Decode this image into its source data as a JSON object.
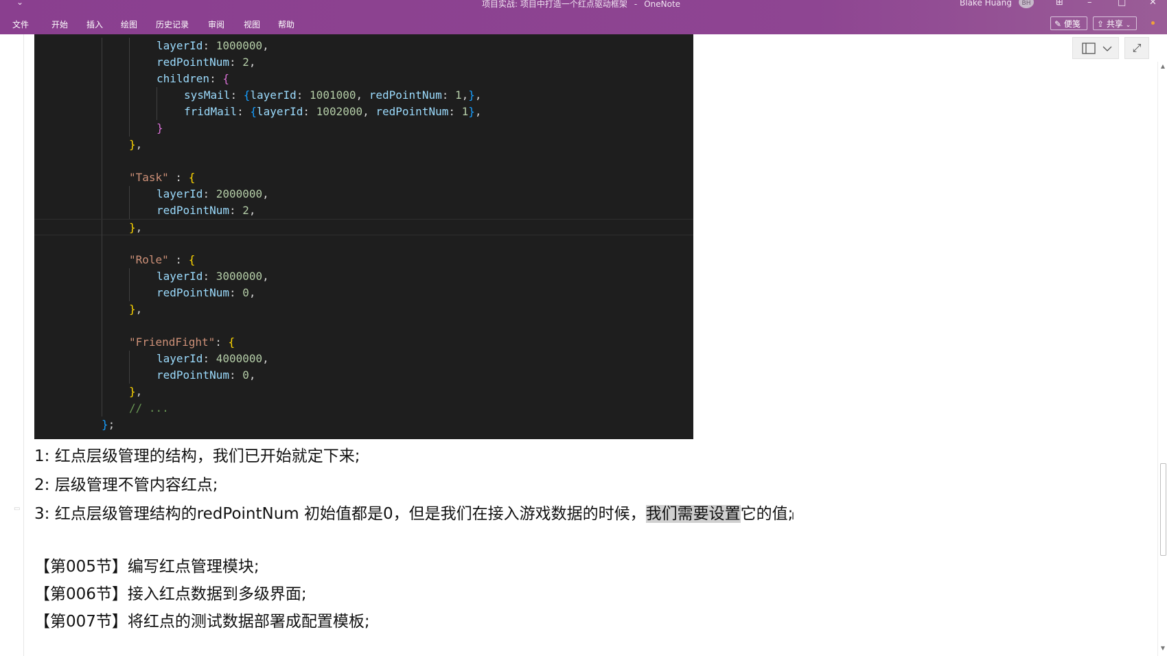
{
  "titlebar": {
    "quick_access": "⌄",
    "doc_title": "项目实战: 项目中打造一个红点驱动框架",
    "separator": "-",
    "app_name": "OneNote",
    "user_name": "Blake Huang",
    "user_initials": "BH"
  },
  "menu": {
    "items": [
      "文件",
      "开始",
      "插入",
      "绘图",
      "历史记录",
      "审阅",
      "视图",
      "帮助"
    ]
  },
  "ribbon_right": {
    "sticky_label": "便笺",
    "share_label": "共享"
  },
  "code": {
    "lines": [
      {
        "indent": 3,
        "tokens": [
          [
            "prop",
            "layerId"
          ],
          [
            "p",
            ": "
          ],
          [
            "num",
            "1000000"
          ],
          [
            "p",
            ","
          ]
        ]
      },
      {
        "indent": 3,
        "tokens": [
          [
            "prop",
            "redPointNum"
          ],
          [
            "p",
            ": "
          ],
          [
            "num",
            "2"
          ],
          [
            "p",
            ","
          ]
        ]
      },
      {
        "indent": 3,
        "tokens": [
          [
            "prop",
            "children"
          ],
          [
            "p",
            ": "
          ],
          [
            "b2",
            "{"
          ]
        ]
      },
      {
        "indent": 4,
        "tokens": [
          [
            "prop",
            "sysMail"
          ],
          [
            "p",
            ": "
          ],
          [
            "b3",
            "{"
          ],
          [
            "prop",
            "layerId"
          ],
          [
            "p",
            ": "
          ],
          [
            "num",
            "1001000"
          ],
          [
            "p",
            ", "
          ],
          [
            "prop",
            "redPointNum"
          ],
          [
            "p",
            ": "
          ],
          [
            "num",
            "1"
          ],
          [
            "p",
            ","
          ],
          [
            "b3",
            "}"
          ],
          [
            "p",
            ","
          ]
        ]
      },
      {
        "indent": 4,
        "tokens": [
          [
            "prop",
            "fridMail"
          ],
          [
            "p",
            ": "
          ],
          [
            "b3",
            "{"
          ],
          [
            "prop",
            "layerId"
          ],
          [
            "p",
            ": "
          ],
          [
            "num",
            "1002000"
          ],
          [
            "p",
            ", "
          ],
          [
            "prop",
            "redPointNum"
          ],
          [
            "p",
            ": "
          ],
          [
            "num",
            "1"
          ],
          [
            "b3",
            "}"
          ],
          [
            "p",
            ","
          ]
        ]
      },
      {
        "indent": 3,
        "tokens": [
          [
            "b2",
            "}"
          ]
        ]
      },
      {
        "indent": 2,
        "tokens": [
          [
            "b1",
            "}"
          ],
          [
            "p",
            ","
          ]
        ]
      },
      {
        "indent": 2,
        "tokens": []
      },
      {
        "indent": 2,
        "tokens": [
          [
            "str",
            "\"Task\""
          ],
          [
            "p",
            " : "
          ],
          [
            "b1",
            "{"
          ]
        ]
      },
      {
        "indent": 3,
        "tokens": [
          [
            "prop",
            "layerId"
          ],
          [
            "p",
            ": "
          ],
          [
            "num",
            "2000000"
          ],
          [
            "p",
            ","
          ]
        ]
      },
      {
        "indent": 3,
        "tokens": [
          [
            "prop",
            "redPointNum"
          ],
          [
            "p",
            ": "
          ],
          [
            "num",
            "2"
          ],
          [
            "p",
            ","
          ]
        ]
      },
      {
        "indent": 2,
        "tokens": [
          [
            "b1",
            "}"
          ],
          [
            "p",
            ","
          ]
        ],
        "current": true
      },
      {
        "indent": 2,
        "tokens": []
      },
      {
        "indent": 2,
        "tokens": [
          [
            "str",
            "\"Role\""
          ],
          [
            "p",
            " : "
          ],
          [
            "b1",
            "{"
          ]
        ]
      },
      {
        "indent": 3,
        "tokens": [
          [
            "prop",
            "layerId"
          ],
          [
            "p",
            ": "
          ],
          [
            "num",
            "3000000"
          ],
          [
            "p",
            ","
          ]
        ]
      },
      {
        "indent": 3,
        "tokens": [
          [
            "prop",
            "redPointNum"
          ],
          [
            "p",
            ": "
          ],
          [
            "num",
            "0"
          ],
          [
            "p",
            ","
          ]
        ]
      },
      {
        "indent": 2,
        "tokens": [
          [
            "b1",
            "}"
          ],
          [
            "p",
            ","
          ]
        ]
      },
      {
        "indent": 2,
        "tokens": []
      },
      {
        "indent": 2,
        "tokens": [
          [
            "str",
            "\"FriendFight\""
          ],
          [
            "p",
            ": "
          ],
          [
            "b1",
            "{"
          ]
        ]
      },
      {
        "indent": 3,
        "tokens": [
          [
            "prop",
            "layerId"
          ],
          [
            "p",
            ": "
          ],
          [
            "num",
            "4000000"
          ],
          [
            "p",
            ","
          ]
        ]
      },
      {
        "indent": 3,
        "tokens": [
          [
            "prop",
            "redPointNum"
          ],
          [
            "p",
            ": "
          ],
          [
            "num",
            "0"
          ],
          [
            "p",
            ","
          ]
        ]
      },
      {
        "indent": 2,
        "tokens": [
          [
            "b1",
            "}"
          ],
          [
            "p",
            ","
          ]
        ]
      },
      {
        "indent": 2,
        "tokens": [
          [
            "cmt",
            "// ..."
          ]
        ]
      },
      {
        "indent": 1,
        "tokens": [
          [
            "b3",
            "}"
          ],
          [
            "p",
            ";"
          ]
        ]
      }
    ]
  },
  "notes": {
    "line1": "1: 红点层级管理的结构，我们已开始就定下来;",
    "line2": "2: 层级管理不管内容红点;",
    "line3_before": "3: 红点层级管理结构的redPointNum 初始值都是0，但是我们在接入游戏数据的时候，",
    "line3_highlight": "我们需要设置",
    "line3_after": "它的值;",
    "section5": "【第005节】编写红点管理模块;",
    "section6": "【第006节】接入红点数据到多级界面;",
    "section7": "【第007节】将红点的测试数据部署成配置模板;"
  },
  "colors": {
    "titlebar": "#8e4592",
    "code_bg": "#1e1e1e",
    "highlight": "#d0d0d0"
  }
}
